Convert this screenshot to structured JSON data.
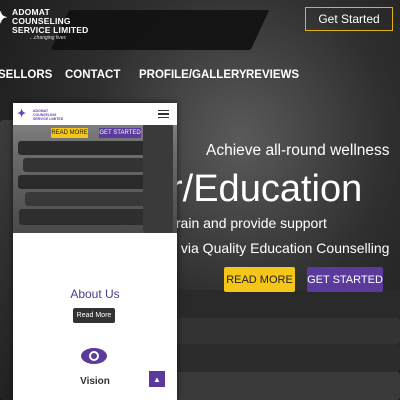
{
  "header": {
    "brand": "ADOMAT COUNSELING SERVICE LIMITED",
    "brand_line1": "ADOMAT",
    "brand_line2": "COUNSELING",
    "brand_line3": "SERVICE LIMITED",
    "tagline": "...changing lives",
    "get_started": "Get Started"
  },
  "nav": {
    "items": [
      "SELLORS",
      "CONTACT",
      "PROFILE/GALLERY",
      "REVIEWS"
    ]
  },
  "hero": {
    "subtitle": "Achieve all-round wellness",
    "headline": "r/Education",
    "line1": "train and provide support",
    "line2": "s via Quality Education Counselling",
    "read_more": "READ MORE",
    "get_started": "GET STARTED"
  },
  "mobile": {
    "logo_line1": "ADOMAT",
    "logo_line2": "COUNSELING",
    "logo_line3": "SERVICE LIMITED",
    "read_more": "READ MORE",
    "get_started": "GET STARTED",
    "about_title": "About Us",
    "about_button": "Read More",
    "vision": "Vision",
    "up_arrow": "▲"
  },
  "colors": {
    "accent_yellow": "#f5c518",
    "accent_purple": "#5a3a9a",
    "button_border": "#e0b21a",
    "about_title": "#4d3b8a"
  }
}
